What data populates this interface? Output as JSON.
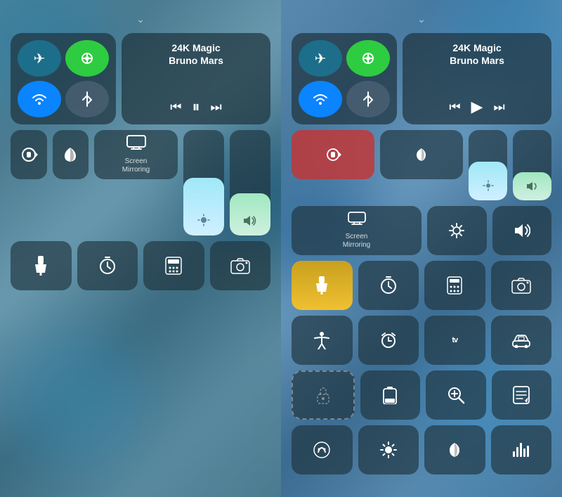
{
  "left_panel": {
    "chevron": "⌄",
    "network": {
      "airplane_label": "airplane",
      "cellular_label": "cellular",
      "wifi_label": "wifi",
      "bluetooth_label": "bluetooth"
    },
    "music": {
      "title": "24K Magic",
      "artist": "Bruno Mars"
    },
    "controls": {
      "rotation_lock_label": "rotation-lock",
      "night_mode_label": "night-mode",
      "screen_mirroring_label": "Screen\nMirroring",
      "flashlight_label": "flashlight",
      "timer_label": "timer",
      "calculator_label": "calculator",
      "camera_label": "camera"
    }
  },
  "right_panel": {
    "chevron": "⌄",
    "music": {
      "title": "24K Magic",
      "artist": "Bruno Mars"
    },
    "controls": {
      "row1": [
        "rotation-lock",
        "night-mode",
        "brightness-slider",
        "volume-slider"
      ],
      "row2": [
        "screen-mirroring",
        "brightness-icon",
        "volume-icon"
      ],
      "row3": [
        "flashlight",
        "timer",
        "calculator",
        "camera"
      ],
      "row4": [
        "accessibility",
        "alarm",
        "apple-tv",
        "car"
      ],
      "row5": [
        "lock-dashed",
        "battery",
        "zoom",
        "notes"
      ],
      "row6": [
        "siri",
        "sun",
        "moon",
        "equalizer"
      ]
    }
  }
}
